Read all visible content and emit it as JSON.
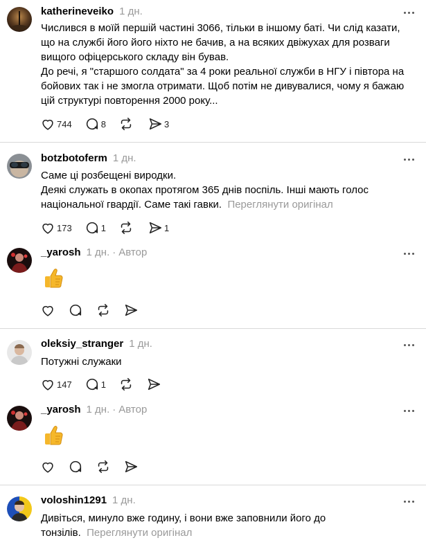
{
  "posts": [
    {
      "username": "katherineveiko",
      "time": "1 дн.",
      "lines": [
        "Числився в моїй першій частині 3066, тільки в іншому баті. Чи слід казати, що на службі його його ніхто не бачив, а на всяких двіжухах для розваги вищого офіцерського складу він бував.",
        "До речі, я \"старшого солдата\" за 4 роки реальної служби в НГУ і півтора на бойових так і не змогла отримати. Щоб потім не дивувалися, чому я бажаю цій структурі повторення 2000 року..."
      ],
      "likes": "744",
      "replies": "8",
      "reposts": "",
      "shares": "3"
    },
    {
      "username": "botzbotoferm",
      "time": "1 дн.",
      "lines": [
        "Саме ці розбещені виродки.",
        "Деякі служать в окопах протягом 365 днів поспіль. Інші мають голос національної гвардії. Саме такі гавки."
      ],
      "translate": "Переглянути оригінал",
      "likes": "173",
      "replies": "1",
      "reposts": "",
      "shares": "1"
    },
    {
      "username": "_yarosh",
      "time": "1 дн.",
      "author_label": "Автор",
      "emoji": "thumbs-up"
    },
    {
      "username": "oleksiy_stranger",
      "time": "1 дн.",
      "lines": [
        "Потужні служаки"
      ],
      "likes": "147",
      "replies": "1",
      "reposts": "",
      "shares": ""
    },
    {
      "username": "_yarosh",
      "time": "1 дн.",
      "author_label": "Автор",
      "emoji": "thumbs-up"
    },
    {
      "username": "voloshin1291",
      "time": "1 дн.",
      "lines": [
        "Дивіться, минуло вже годину, і вони вже заповнили його до тонзілів."
      ],
      "translate": "Переглянути оригінал"
    }
  ],
  "colors": {
    "meta": "#999999",
    "divider": "#d9d9d9",
    "thumb": "#f5b72b"
  },
  "icons": [
    "heart-icon",
    "comment-icon",
    "repost-icon",
    "share-icon",
    "more-icon"
  ]
}
